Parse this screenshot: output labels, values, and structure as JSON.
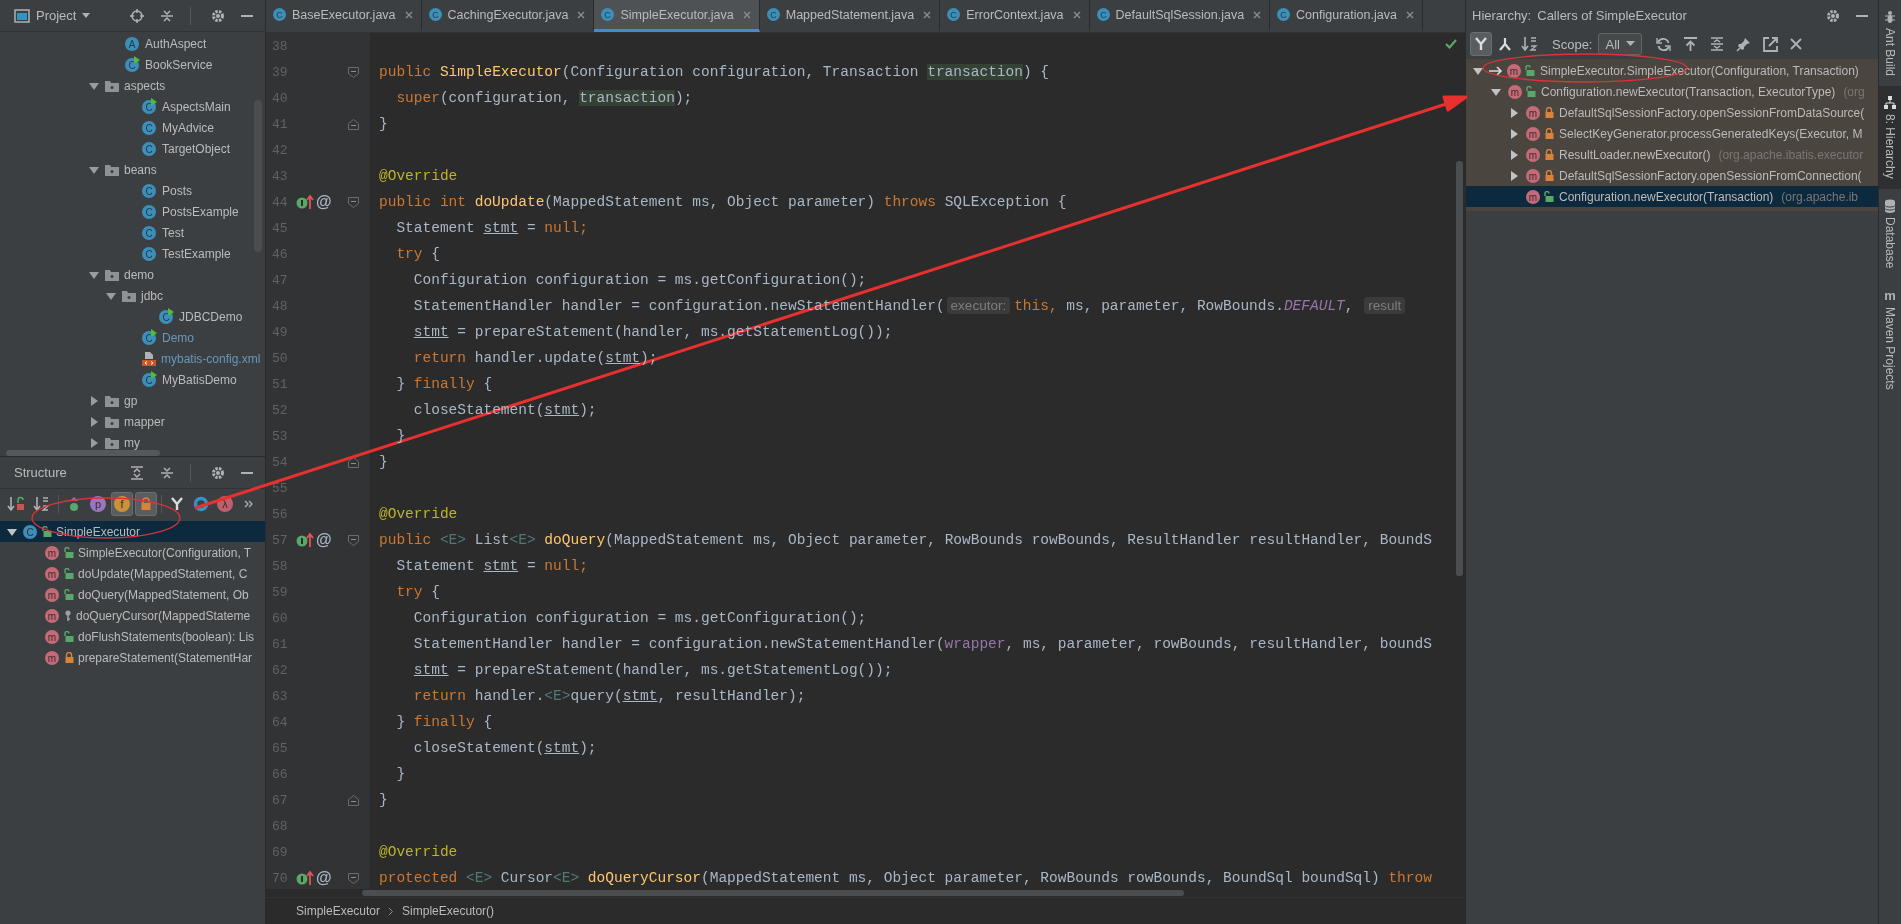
{
  "project_panel": {
    "title": "Project",
    "tree": [
      {
        "label": "AuthAspect",
        "kind": "annotation",
        "icon": "A",
        "modified": false
      },
      {
        "label": "BookService",
        "kind": "runnable",
        "icon": "C",
        "modified": false
      },
      {
        "label": "aspects",
        "kind": "folder",
        "expanded": true,
        "modified": false,
        "children": [
          {
            "label": "AspectsMain",
            "kind": "runnable",
            "icon": "C",
            "modified": false
          },
          {
            "label": "MyAdvice",
            "kind": "class",
            "icon": "C",
            "modified": false
          },
          {
            "label": "TargetObject",
            "kind": "class",
            "icon": "C",
            "modified": false
          }
        ]
      },
      {
        "label": "beans",
        "kind": "folder",
        "expanded": true,
        "modified": false,
        "children": [
          {
            "label": "Posts",
            "kind": "class",
            "icon": "C",
            "modified": false
          },
          {
            "label": "PostsExample",
            "kind": "class",
            "icon": "C",
            "modified": false
          },
          {
            "label": "Test",
            "kind": "class",
            "icon": "C",
            "modified": false
          },
          {
            "label": "TestExample",
            "kind": "class",
            "icon": "C",
            "modified": false
          }
        ]
      },
      {
        "label": "demo",
        "kind": "folder",
        "expanded": true,
        "modified": false,
        "children": [
          {
            "label": "jdbc",
            "kind": "folder",
            "expanded": true,
            "modified": false,
            "children": [
              {
                "label": "JDBCDemo",
                "kind": "runnable",
                "icon": "C",
                "modified": false
              }
            ]
          },
          {
            "label": "Demo",
            "kind": "runnable",
            "icon": "C",
            "modified": true
          },
          {
            "label": "mybatis-config.xml",
            "kind": "xml",
            "modified": true
          },
          {
            "label": "MyBatisDemo",
            "kind": "runnable",
            "icon": "C",
            "modified": false
          }
        ]
      },
      {
        "label": "gp",
        "kind": "folder",
        "expanded": false,
        "modified": false
      },
      {
        "label": "mapper",
        "kind": "folder",
        "expanded": false,
        "modified": false
      },
      {
        "label": "my",
        "kind": "folder",
        "expanded": false,
        "modified": false
      }
    ]
  },
  "structure_panel": {
    "title": "Structure",
    "toolbar": [
      {
        "kind": "sort-visibility",
        "selected": false
      },
      {
        "kind": "sort-alpha",
        "selected": false
      },
      {
        "kind": "inherited",
        "selected": false
      },
      {
        "kind": "letter",
        "letter": "p",
        "color": "#9876c6",
        "selected": false
      },
      {
        "kind": "letter",
        "letter": "f",
        "color": "#c9923a",
        "selected": true
      },
      {
        "kind": "lock",
        "selected": true
      },
      {
        "kind": "tree",
        "selected": false
      },
      {
        "kind": "ring",
        "selected": false
      },
      {
        "kind": "letter",
        "letter": "λ",
        "color": "#c0606e",
        "selected": false
      },
      {
        "kind": "more",
        "selected": false
      }
    ],
    "tree": [
      {
        "label": "SimpleExecutor",
        "icon": "C",
        "kind": "public",
        "selected": true,
        "expanded": true,
        "children": [
          {
            "label": "SimpleExecutor(Configuration, T",
            "icon": "m",
            "kind": "public",
            "selected": false
          },
          {
            "label": "doUpdate(MappedStatement, C",
            "icon": "m",
            "kind": "public",
            "selected": false
          },
          {
            "label": "doQuery(MappedStatement, Ob",
            "icon": "m",
            "kind": "public",
            "selected": false
          },
          {
            "label": "doQueryCursor(MappedStateme",
            "icon": "m",
            "kind": "protected",
            "selected": false
          },
          {
            "label": "doFlushStatements(boolean): Lis",
            "icon": "m",
            "kind": "public",
            "selected": false
          },
          {
            "label": "prepareStatement(StatementHar",
            "icon": "m",
            "kind": "private",
            "selected": false
          }
        ]
      }
    ]
  },
  "editor": {
    "tabs": [
      {
        "label": "BaseExecutor.java",
        "icon": "C",
        "selected": false
      },
      {
        "label": "CachingExecutor.java",
        "icon": "C",
        "selected": false
      },
      {
        "label": "SimpleExecutor.java",
        "icon": "C",
        "selected": true
      },
      {
        "label": "MappedStatement.java",
        "icon": "C",
        "selected": false
      },
      {
        "label": "ErrorContext.java",
        "icon": "C",
        "selected": false
      },
      {
        "label": "DefaultSqlSession.java",
        "icon": "C",
        "selected": false
      },
      {
        "label": "Configuration.java",
        "icon": "C",
        "selected": false
      }
    ],
    "lines": [
      {
        "number": "38",
        "kind": "plain"
      },
      {
        "number": "39",
        "kind": "fold-start",
        "tokens": [
          {
            "kind": "keyword",
            "t": "public "
          },
          {
            "kind": "method",
            "t": "SimpleExecutor"
          },
          {
            "kind": "plain",
            "t": "(Configuration configuration, Transaction "
          },
          {
            "kind": "highlight",
            "t": "transaction"
          },
          {
            "kind": "plain",
            "t": ") {"
          }
        ]
      },
      {
        "number": "40",
        "kind": "plain",
        "tokens": [
          {
            "kind": "keyword",
            "t": "  super"
          },
          {
            "kind": "plain",
            "t": "(configuration, "
          },
          {
            "kind": "highlight",
            "t": "transaction"
          },
          {
            "kind": "plain",
            "t": ");"
          }
        ]
      },
      {
        "number": "41",
        "kind": "fold-end",
        "tokens": [
          {
            "kind": "plain",
            "t": "}"
          }
        ]
      },
      {
        "number": "42",
        "kind": "plain"
      },
      {
        "number": "43",
        "kind": "plain",
        "tokens": [
          {
            "kind": "annotation",
            "t": "@Override"
          }
        ]
      },
      {
        "number": "44",
        "kind": "fold-start",
        "gutter": "@",
        "tokens": [
          {
            "kind": "keyword",
            "t": "public int "
          },
          {
            "kind": "method",
            "t": "doUpdate"
          },
          {
            "kind": "plain",
            "t": "(MappedStatement ms, Object parameter) "
          },
          {
            "kind": "keyword",
            "t": "throws "
          },
          {
            "kind": "plain",
            "t": "SQLException {"
          }
        ]
      },
      {
        "number": "45",
        "kind": "plain",
        "tokens": [
          {
            "kind": "plain",
            "t": "  Statement "
          },
          {
            "kind": "local",
            "t": "stmt"
          },
          {
            "kind": "plain",
            "t": " = "
          },
          {
            "kind": "keyword",
            "t": "null;"
          }
        ]
      },
      {
        "number": "46",
        "kind": "plain",
        "tokens": [
          {
            "kind": "keyword",
            "t": "  try "
          },
          {
            "kind": "plain",
            "t": "{"
          }
        ]
      },
      {
        "number": "47",
        "kind": "plain",
        "tokens": [
          {
            "kind": "plain",
            "t": "    Configuration configuration = ms.getConfiguration();"
          }
        ]
      },
      {
        "number": "48",
        "kind": "plain",
        "tokens": [
          {
            "kind": "plain",
            "t": "    StatementHandler handler = configuration.newStatementHandler("
          },
          {
            "kind": "hint",
            "t": "executor:"
          },
          {
            "kind": "keyword",
            "t": "this, "
          },
          {
            "kind": "plain",
            "t": "ms, parameter, RowBounds."
          },
          {
            "kind": "constant",
            "t": "DEFAULT"
          },
          {
            "kind": "plain",
            "t": ", "
          },
          {
            "kind": "hint",
            "t": "result"
          }
        ]
      },
      {
        "number": "49",
        "kind": "plain",
        "tokens": [
          {
            "kind": "local",
            "t": "    stmt"
          },
          {
            "kind": "plain",
            "t": " = prepareStatement(handler, ms.getStatementLog());"
          }
        ]
      },
      {
        "number": "50",
        "kind": "plain",
        "tokens": [
          {
            "kind": "keyword",
            "t": "    return "
          },
          {
            "kind": "plain",
            "t": "handler.update("
          },
          {
            "kind": "local",
            "t": "stmt"
          },
          {
            "kind": "plain",
            "t": ");"
          }
        ]
      },
      {
        "number": "51",
        "kind": "plain",
        "tokens": [
          {
            "kind": "plain",
            "t": "  } "
          },
          {
            "kind": "keyword",
            "t": "finally "
          },
          {
            "kind": "plain",
            "t": "{"
          }
        ]
      },
      {
        "number": "52",
        "kind": "plain",
        "tokens": [
          {
            "kind": "plain",
            "t": "    closeStatement("
          },
          {
            "kind": "local",
            "t": "stmt"
          },
          {
            "kind": "plain",
            "t": ");"
          }
        ]
      },
      {
        "number": "53",
        "kind": "plain",
        "tokens": [
          {
            "kind": "plain",
            "t": "  }"
          }
        ]
      },
      {
        "number": "54",
        "kind": "fold-end",
        "tokens": [
          {
            "kind": "plain",
            "t": "}"
          }
        ]
      },
      {
        "number": "55",
        "kind": "plain"
      },
      {
        "number": "56",
        "kind": "plain",
        "tokens": [
          {
            "kind": "annotation",
            "t": "@Override"
          }
        ]
      },
      {
        "number": "57",
        "kind": "fold-start",
        "gutter": "@",
        "tokens": [
          {
            "kind": "keyword",
            "t": "public "
          },
          {
            "kind": "generic",
            "t": "<E>"
          },
          {
            "kind": "plain",
            "t": " List"
          },
          {
            "kind": "generic",
            "t": "<E> "
          },
          {
            "kind": "method",
            "t": "doQuery"
          },
          {
            "kind": "plain",
            "t": "(MappedStatement ms, Object parameter, RowBounds rowBounds, ResultHandler resultHandler, BoundS"
          }
        ]
      },
      {
        "number": "58",
        "kind": "plain",
        "tokens": [
          {
            "kind": "plain",
            "t": "  Statement "
          },
          {
            "kind": "local",
            "t": "stmt"
          },
          {
            "kind": "plain",
            "t": " = "
          },
          {
            "kind": "keyword",
            "t": "null;"
          }
        ]
      },
      {
        "number": "59",
        "kind": "plain",
        "tokens": [
          {
            "kind": "keyword",
            "t": "  try "
          },
          {
            "kind": "plain",
            "t": "{"
          }
        ]
      },
      {
        "number": "60",
        "kind": "plain",
        "tokens": [
          {
            "kind": "plain",
            "t": "    Configuration configuration = ms.getConfiguration();"
          }
        ]
      },
      {
        "number": "61",
        "kind": "plain",
        "tokens": [
          {
            "kind": "plain",
            "t": "    StatementHandler handler = configuration.newStatementHandler("
          },
          {
            "kind": "field",
            "t": "wrapper"
          },
          {
            "kind": "plain",
            "t": ", ms, parameter, rowBounds, resultHandler, boundS"
          }
        ]
      },
      {
        "number": "62",
        "kind": "plain",
        "tokens": [
          {
            "kind": "local",
            "t": "    stmt"
          },
          {
            "kind": "plain",
            "t": " = prepareStatement(handler, ms.getStatementLog());"
          }
        ]
      },
      {
        "number": "63",
        "kind": "plain",
        "tokens": [
          {
            "kind": "keyword",
            "t": "    return "
          },
          {
            "kind": "plain",
            "t": "handler."
          },
          {
            "kind": "generic",
            "t": "<E>"
          },
          {
            "kind": "plain",
            "t": "query("
          },
          {
            "kind": "local",
            "t": "stmt"
          },
          {
            "kind": "plain",
            "t": ", resultHandler);"
          }
        ]
      },
      {
        "number": "64",
        "kind": "plain",
        "tokens": [
          {
            "kind": "plain",
            "t": "  } "
          },
          {
            "kind": "keyword",
            "t": "finally "
          },
          {
            "kind": "plain",
            "t": "{"
          }
        ]
      },
      {
        "number": "65",
        "kind": "plain",
        "tokens": [
          {
            "kind": "plain",
            "t": "    closeStatement("
          },
          {
            "kind": "local",
            "t": "stmt"
          },
          {
            "kind": "plain",
            "t": ");"
          }
        ]
      },
      {
        "number": "66",
        "kind": "plain",
        "tokens": [
          {
            "kind": "plain",
            "t": "  }"
          }
        ]
      },
      {
        "number": "67",
        "kind": "fold-end",
        "tokens": [
          {
            "kind": "plain",
            "t": "}"
          }
        ]
      },
      {
        "number": "68",
        "kind": "plain"
      },
      {
        "number": "69",
        "kind": "plain",
        "tokens": [
          {
            "kind": "annotation",
            "t": "@Override"
          }
        ]
      },
      {
        "number": "70",
        "kind": "fold-start",
        "gutter": "@",
        "tokens": [
          {
            "kind": "keyword",
            "t": "protected "
          },
          {
            "kind": "generic",
            "t": "<E>"
          },
          {
            "kind": "plain",
            "t": " Cursor"
          },
          {
            "kind": "generic",
            "t": "<E> "
          },
          {
            "kind": "method",
            "t": "doQueryCursor"
          },
          {
            "kind": "plain",
            "t": "(MappedStatement ms, Object parameter, RowBounds rowBounds, BoundSql boundSql) "
          },
          {
            "kind": "keyword",
            "t": "throw"
          }
        ]
      }
    ],
    "breadcrumbs": [
      "SimpleExecutor",
      "SimpleExecutor()"
    ]
  },
  "hierarchy_panel": {
    "title": "Hierarchy:",
    "subtitle": "Callers of SimpleExecutor",
    "toolbar": [
      {
        "kind": "callers",
        "selected": true
      },
      {
        "kind": "callees",
        "selected": false
      },
      {
        "kind": "sort-alpha",
        "selected": false
      }
    ],
    "scope_label": "Scope:",
    "scope_value": "All",
    "actions": [
      {
        "kind": "refresh"
      },
      {
        "kind": "export"
      },
      {
        "kind": "expand"
      },
      {
        "kind": "pin"
      },
      {
        "kind": "open-window"
      },
      {
        "kind": "close"
      }
    ],
    "tree": [
      {
        "label": "SimpleExecutor.SimpleExecutor(Configuration, Transaction)",
        "kind": "public",
        "icon": "m",
        "current": true,
        "expanded": true,
        "selected": false,
        "children": [
          {
            "label": "Configuration.newExecutor(Transaction, ExecutorType)",
            "location": "(org",
            "kind": "public",
            "icon": "m",
            "current": false,
            "expanded": true,
            "selected": false,
            "children": [
              {
                "label": "DefaultSqlSessionFactory.openSessionFromDataSource(",
                "kind": "private",
                "icon": "m",
                "current": false,
                "expanded": false,
                "selected": false
              },
              {
                "label": "SelectKeyGenerator.processGeneratedKeys(Executor, M",
                "kind": "private",
                "icon": "m",
                "current": false,
                "expanded": false,
                "selected": false
              },
              {
                "label": "ResultLoader.newExecutor()",
                "location": "(org.apache.ibatis.executor",
                "kind": "private",
                "icon": "m",
                "current": false,
                "expanded": false,
                "selected": false
              },
              {
                "label": "DefaultSqlSessionFactory.openSessionFromConnection(",
                "kind": "private",
                "icon": "m",
                "current": false,
                "expanded": false,
                "selected": false
              },
              {
                "label": "Configuration.newExecutor(Transaction)",
                "location": "(org.apache.ib",
                "kind": "public",
                "icon": "m",
                "current": false,
                "selected": true
              }
            ]
          }
        ]
      }
    ]
  },
  "side_strip": [
    {
      "label": "Ant Build",
      "kind": "ant",
      "selected": false
    },
    {
      "label": "8: Hierarchy",
      "kind": "hierarchy",
      "selected": true
    },
    {
      "label": "Database",
      "kind": "database",
      "selected": false
    },
    {
      "label": "Maven Projects",
      "kind": "maven",
      "letter": "m",
      "selected": false
    }
  ]
}
